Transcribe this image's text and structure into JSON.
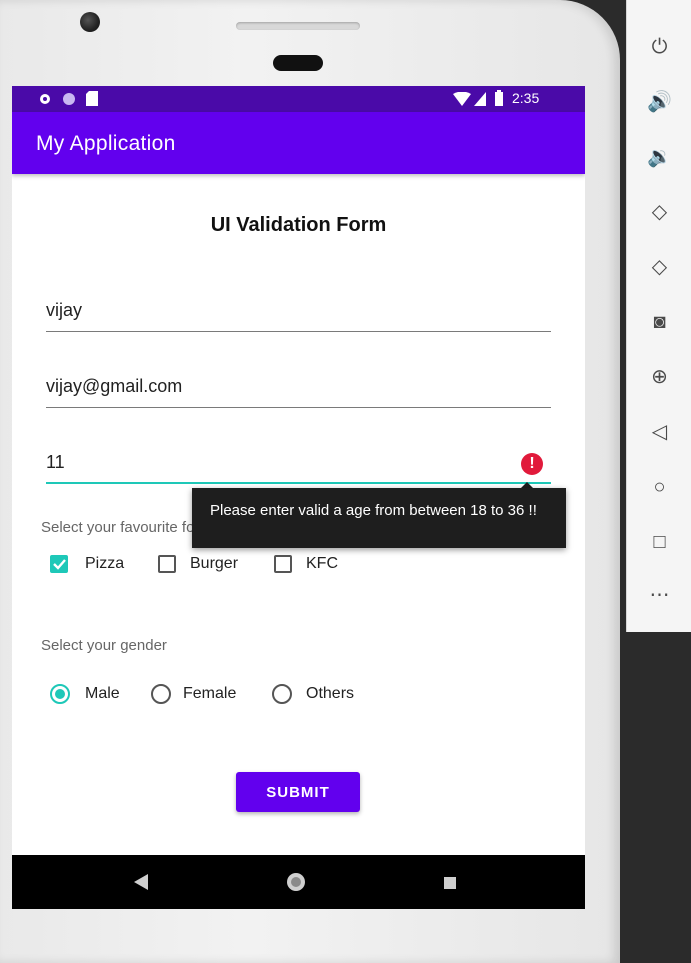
{
  "status_bar": {
    "time": "2:35"
  },
  "app_bar": {
    "title": "My Application"
  },
  "form": {
    "title": "UI Validation Form",
    "name_value": "vijay",
    "email_value": "vijay@gmail.com",
    "age_value": "11",
    "age_error": "Please enter valid a age from between 18 to 36 !!",
    "food_label": "Select your favourite foods",
    "foods": [
      {
        "label": "Pizza",
        "checked": true
      },
      {
        "label": "Burger",
        "checked": false
      },
      {
        "label": "KFC",
        "checked": false
      }
    ],
    "gender_label": "Select your gender",
    "genders": [
      {
        "label": "Male",
        "checked": true
      },
      {
        "label": "Female",
        "checked": false
      },
      {
        "label": "Others",
        "checked": false
      }
    ],
    "submit_label": "SUBMIT"
  },
  "colors": {
    "primary": "#6200ee",
    "status_bar": "#4a0aa8",
    "accent": "#1ec8b8",
    "error": "#e11a3b"
  },
  "emulator_toolbar": [
    "power-icon",
    "volume-up-icon",
    "volume-down-icon",
    "rotate-left-icon",
    "rotate-right-icon",
    "camera-icon",
    "zoom-icon",
    "back-icon",
    "home-icon",
    "overview-icon",
    "more-icon"
  ]
}
